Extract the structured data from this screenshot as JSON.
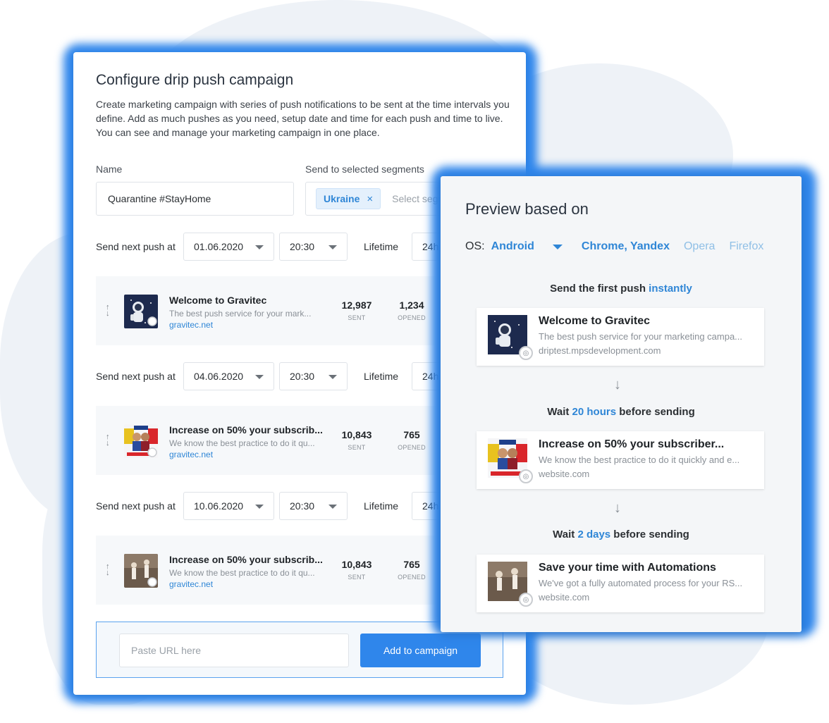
{
  "campaign": {
    "title": "Configure drip push campaign",
    "description": "Create marketing campaign with series of push notifications to be sent at the time intervals you define. Add as much pushes as you need, setup date and time for each push and time to live. You can see and manage your marketing campaign in one place.",
    "name_label": "Name",
    "name_value": "Quarantine #StayHome",
    "segments_label": "Send to selected segments",
    "segment_tag": "Ukraine",
    "segment_remove": "×",
    "segments_placeholder": "Select segments",
    "schedule": [
      {
        "label": "Send next push at",
        "date": "01.06.2020",
        "time": "20:30",
        "lifetime_label": "Lifetime",
        "lifetime": "24h"
      },
      {
        "label": "Send next push at",
        "date": "04.06.2020",
        "time": "20:30",
        "lifetime_label": "Lifetime",
        "lifetime": "24h"
      },
      {
        "label": "Send next push at",
        "date": "10.06.2020",
        "time": "20:30",
        "lifetime_label": "Lifetime",
        "lifetime": "24h"
      }
    ],
    "pushes": [
      {
        "title": "Welcome to Gravitec",
        "body": "The best push service for your mark...",
        "url": "gravitec.net",
        "sent": "12,987",
        "opened": "1,234",
        "sent_label": "SENT",
        "opened_label": "OPENED"
      },
      {
        "title": "Increase on 50% your subscrib...",
        "body": "We know the best practice to do it qu...",
        "url": "gravitec.net",
        "sent": "10,843",
        "opened": "765",
        "sent_label": "SENT",
        "opened_label": "OPENED"
      },
      {
        "title": "Increase on 50% your subscrib...",
        "body": "We know the best practice to do it qu...",
        "url": "gravitec.net",
        "sent": "10,843",
        "opened": "765",
        "sent_label": "SENT",
        "opened_label": "OPENED"
      }
    ],
    "url_placeholder": "Paste URL here",
    "add_button": "Add to campaign"
  },
  "preview": {
    "title": "Preview based on",
    "os_label": "OS:",
    "os_value": "Android",
    "browsers": [
      "Chrome, Yandex",
      "Opera",
      "Firefox"
    ],
    "steps": [
      {
        "prefix": "Send the first push ",
        "highlight": "instantly",
        "suffix": ""
      },
      {
        "prefix": "Wait ",
        "highlight": "20 hours",
        "suffix": " before sending"
      },
      {
        "prefix": "Wait ",
        "highlight": "2 days",
        "suffix": " before sending"
      }
    ],
    "cards": [
      {
        "title": "Welcome to Gravitec",
        "body": "The best push service for your marketing campa...",
        "url": "driptest.mpsdevelopment.com"
      },
      {
        "title": "Increase on 50% your subscriber...",
        "body": "We know the best practice to do it quickly and e...",
        "url": "website.com"
      },
      {
        "title": "Save your time with Automations",
        "body": "We've got a fully automated process for your RS...",
        "url": "website.com"
      }
    ],
    "arrow": "↓"
  },
  "icons": {
    "sort": "sort-arrows-icon",
    "caret": "caret-down-icon",
    "browser_badge": "chrome-icon"
  },
  "colors": {
    "accent": "#2f86eb",
    "link": "#2f86d6",
    "muted_link": "#8fbfe6"
  }
}
